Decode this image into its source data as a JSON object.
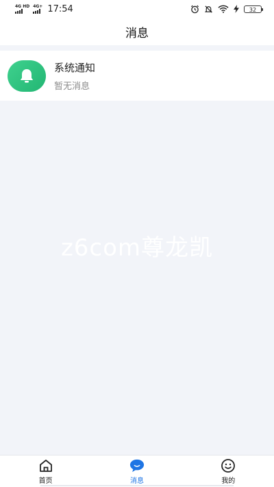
{
  "status_bar": {
    "network1": "4G HD",
    "network2": "4G+",
    "time": "17:54",
    "battery": "32",
    "icons": [
      "alarm-icon",
      "mute-icon",
      "wifi-icon",
      "charging-icon"
    ]
  },
  "header": {
    "title": "消息"
  },
  "notifications": [
    {
      "icon": "bell-icon",
      "title": "系统通知",
      "subtitle": "暂无消息",
      "icon_color": "#2fc47f"
    }
  ],
  "watermark": "z6com尊龙凯",
  "tabbar": {
    "items": [
      {
        "label": "首页",
        "icon": "home-icon",
        "active": false
      },
      {
        "label": "消息",
        "icon": "message-icon",
        "active": true
      },
      {
        "label": "我的",
        "icon": "profile-icon",
        "active": false
      }
    ],
    "active_color": "#1f75e4"
  }
}
